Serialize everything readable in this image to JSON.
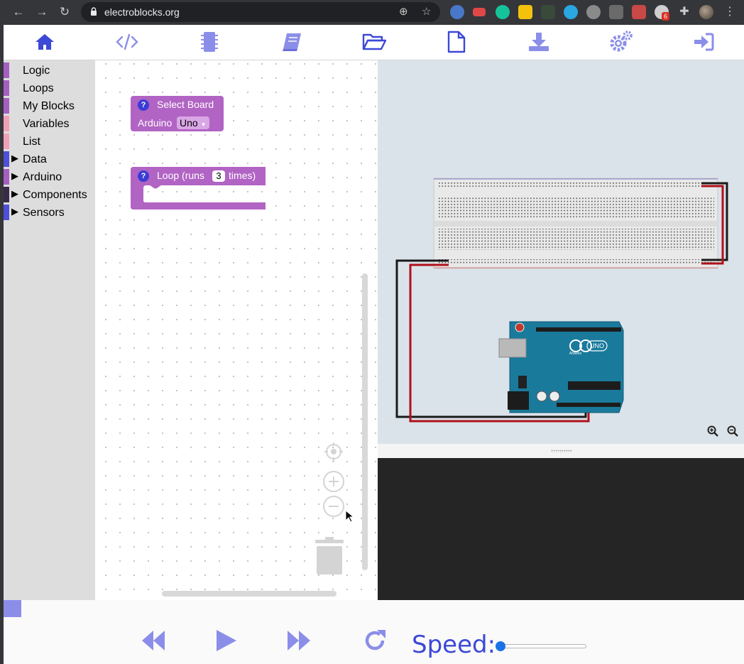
{
  "browser": {
    "url": "electroblocks.org",
    "extension_badge": "6"
  },
  "toolbar": {
    "buttons": [
      "home-icon",
      "code-icon",
      "chip-icon",
      "book-icon",
      "folder-open-icon",
      "new-file-icon",
      "download-icon",
      "settings-icon",
      "sign-in-icon"
    ]
  },
  "sidebar": {
    "categories": [
      {
        "label": "Logic",
        "color": "#a55fc2",
        "expandable": false
      },
      {
        "label": "Loops",
        "color": "#a55fc2",
        "expandable": false
      },
      {
        "label": "My Blocks",
        "color": "#a55fc2",
        "expandable": false
      },
      {
        "label": "Variables",
        "color": "#f0a0b8",
        "expandable": false
      },
      {
        "label": "List",
        "color": "#f0a0b8",
        "expandable": false
      },
      {
        "label": "Data",
        "color": "#4f4fd8",
        "expandable": true
      },
      {
        "label": "Arduino",
        "color": "#a55fc2",
        "expandable": true
      },
      {
        "label": "Components",
        "color": "#3a2a4a",
        "expandable": true
      },
      {
        "label": "Sensors",
        "color": "#4f4fd8",
        "expandable": true
      }
    ]
  },
  "blocks": {
    "select_board": {
      "title": "Select Board",
      "field_label": "Arduino",
      "field_value": "Uno",
      "help": "?"
    },
    "loop": {
      "prefix": "Loop (runs",
      "count": "3",
      "suffix": "times)",
      "help": "?"
    }
  },
  "simulator": {
    "board_label": "UNO",
    "board_brand": "Arduino"
  },
  "bottom": {
    "speed_label": "Speed:",
    "speed_value": 0
  },
  "colors": {
    "accent": "#5a5ee0",
    "block": "#b164c4",
    "wire_red": "#b0101a",
    "wire_black": "#1a1a1a",
    "board": "#1a7a9c"
  }
}
